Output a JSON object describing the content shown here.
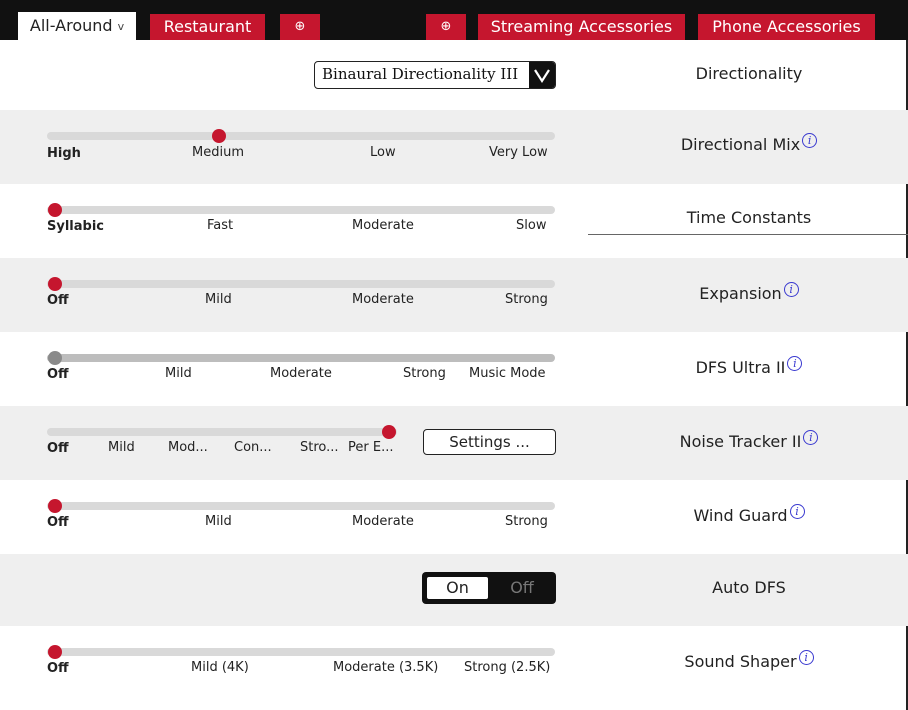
{
  "tabs": [
    {
      "label": "All-Around",
      "active": true,
      "chevron": "v"
    },
    {
      "label": "Restaurant"
    },
    {
      "label": "⊕"
    },
    {
      "label": "⊕"
    },
    {
      "label": "Streaming Accessories"
    },
    {
      "label": "Phone Accessories"
    }
  ],
  "info_icon_glyph": "i",
  "rows": {
    "directionality": {
      "label": "Directionality",
      "dropdown_value": "Binaural Directionality III"
    },
    "directional_mix": {
      "label": "Directional Mix",
      "ticks": [
        "High",
        "Medium",
        "Low",
        "Very Low"
      ],
      "selected_index": 1
    },
    "time_constants": {
      "label": "Time Constants",
      "ticks": [
        "Syllabic",
        "Fast",
        "Moderate",
        "Slow"
      ],
      "selected_index": 0
    },
    "expansion": {
      "label": "Expansion",
      "ticks": [
        "Off",
        "Mild",
        "Moderate",
        "Strong"
      ],
      "selected_index": 0
    },
    "dfs_ultra": {
      "label": "DFS Ultra II",
      "ticks": [
        "Off",
        "Mild",
        "Moderate",
        "Strong",
        "Music Mode"
      ],
      "selected_index": 0
    },
    "noise_tracker": {
      "label": "Noise Tracker II",
      "ticks": [
        "Off",
        "Mild",
        "Mod...",
        "Con...",
        "Stro...",
        "Per E..."
      ],
      "selected_index": 5,
      "button_label": "Settings ..."
    },
    "wind_guard": {
      "label": "Wind Guard",
      "ticks": [
        "Off",
        "Mild",
        "Moderate",
        "Strong"
      ],
      "selected_index": 0
    },
    "auto_dfs": {
      "label": "Auto DFS",
      "on_label": "On",
      "off_label": "Off",
      "value": "On"
    },
    "sound_shaper": {
      "label": "Sound Shaper",
      "ticks": [
        "Off",
        "Mild (4K)",
        "Moderate (3.5K)",
        "Strong (2.5K)"
      ],
      "selected_index": 0
    }
  },
  "colors": {
    "accent": "#c5162e",
    "header_bg": "#111111",
    "row_alt": "#efefef",
    "info_icon": "#3a3ad0"
  }
}
